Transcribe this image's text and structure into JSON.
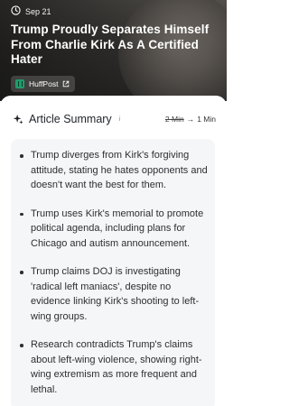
{
  "header": {
    "date": "Sep 21",
    "headline": "Trump Proudly Separates Himself From Charlie Kirk As A Certified Hater",
    "source": "HuffPost"
  },
  "summary": {
    "title": "Article Summary",
    "info": "i",
    "readtime_old": "2 Min",
    "readtime_arrow": "→",
    "readtime_new": "1 Min",
    "bullets": [
      "Trump diverges from Kirk's forgiving attitude, stating he hates opponents and doesn't want the best for them.",
      "Trump uses Kirk's memorial to promote political agenda, including plans for Chicago and autism announcement.",
      "Trump claims DOJ is investigating 'radical left maniacs', despite no evidence linking Kirk's shooting to left-wing groups.",
      "Research contradicts Trump's claims about left-wing violence, showing right-wing extremism as more frequent and lethal."
    ]
  }
}
